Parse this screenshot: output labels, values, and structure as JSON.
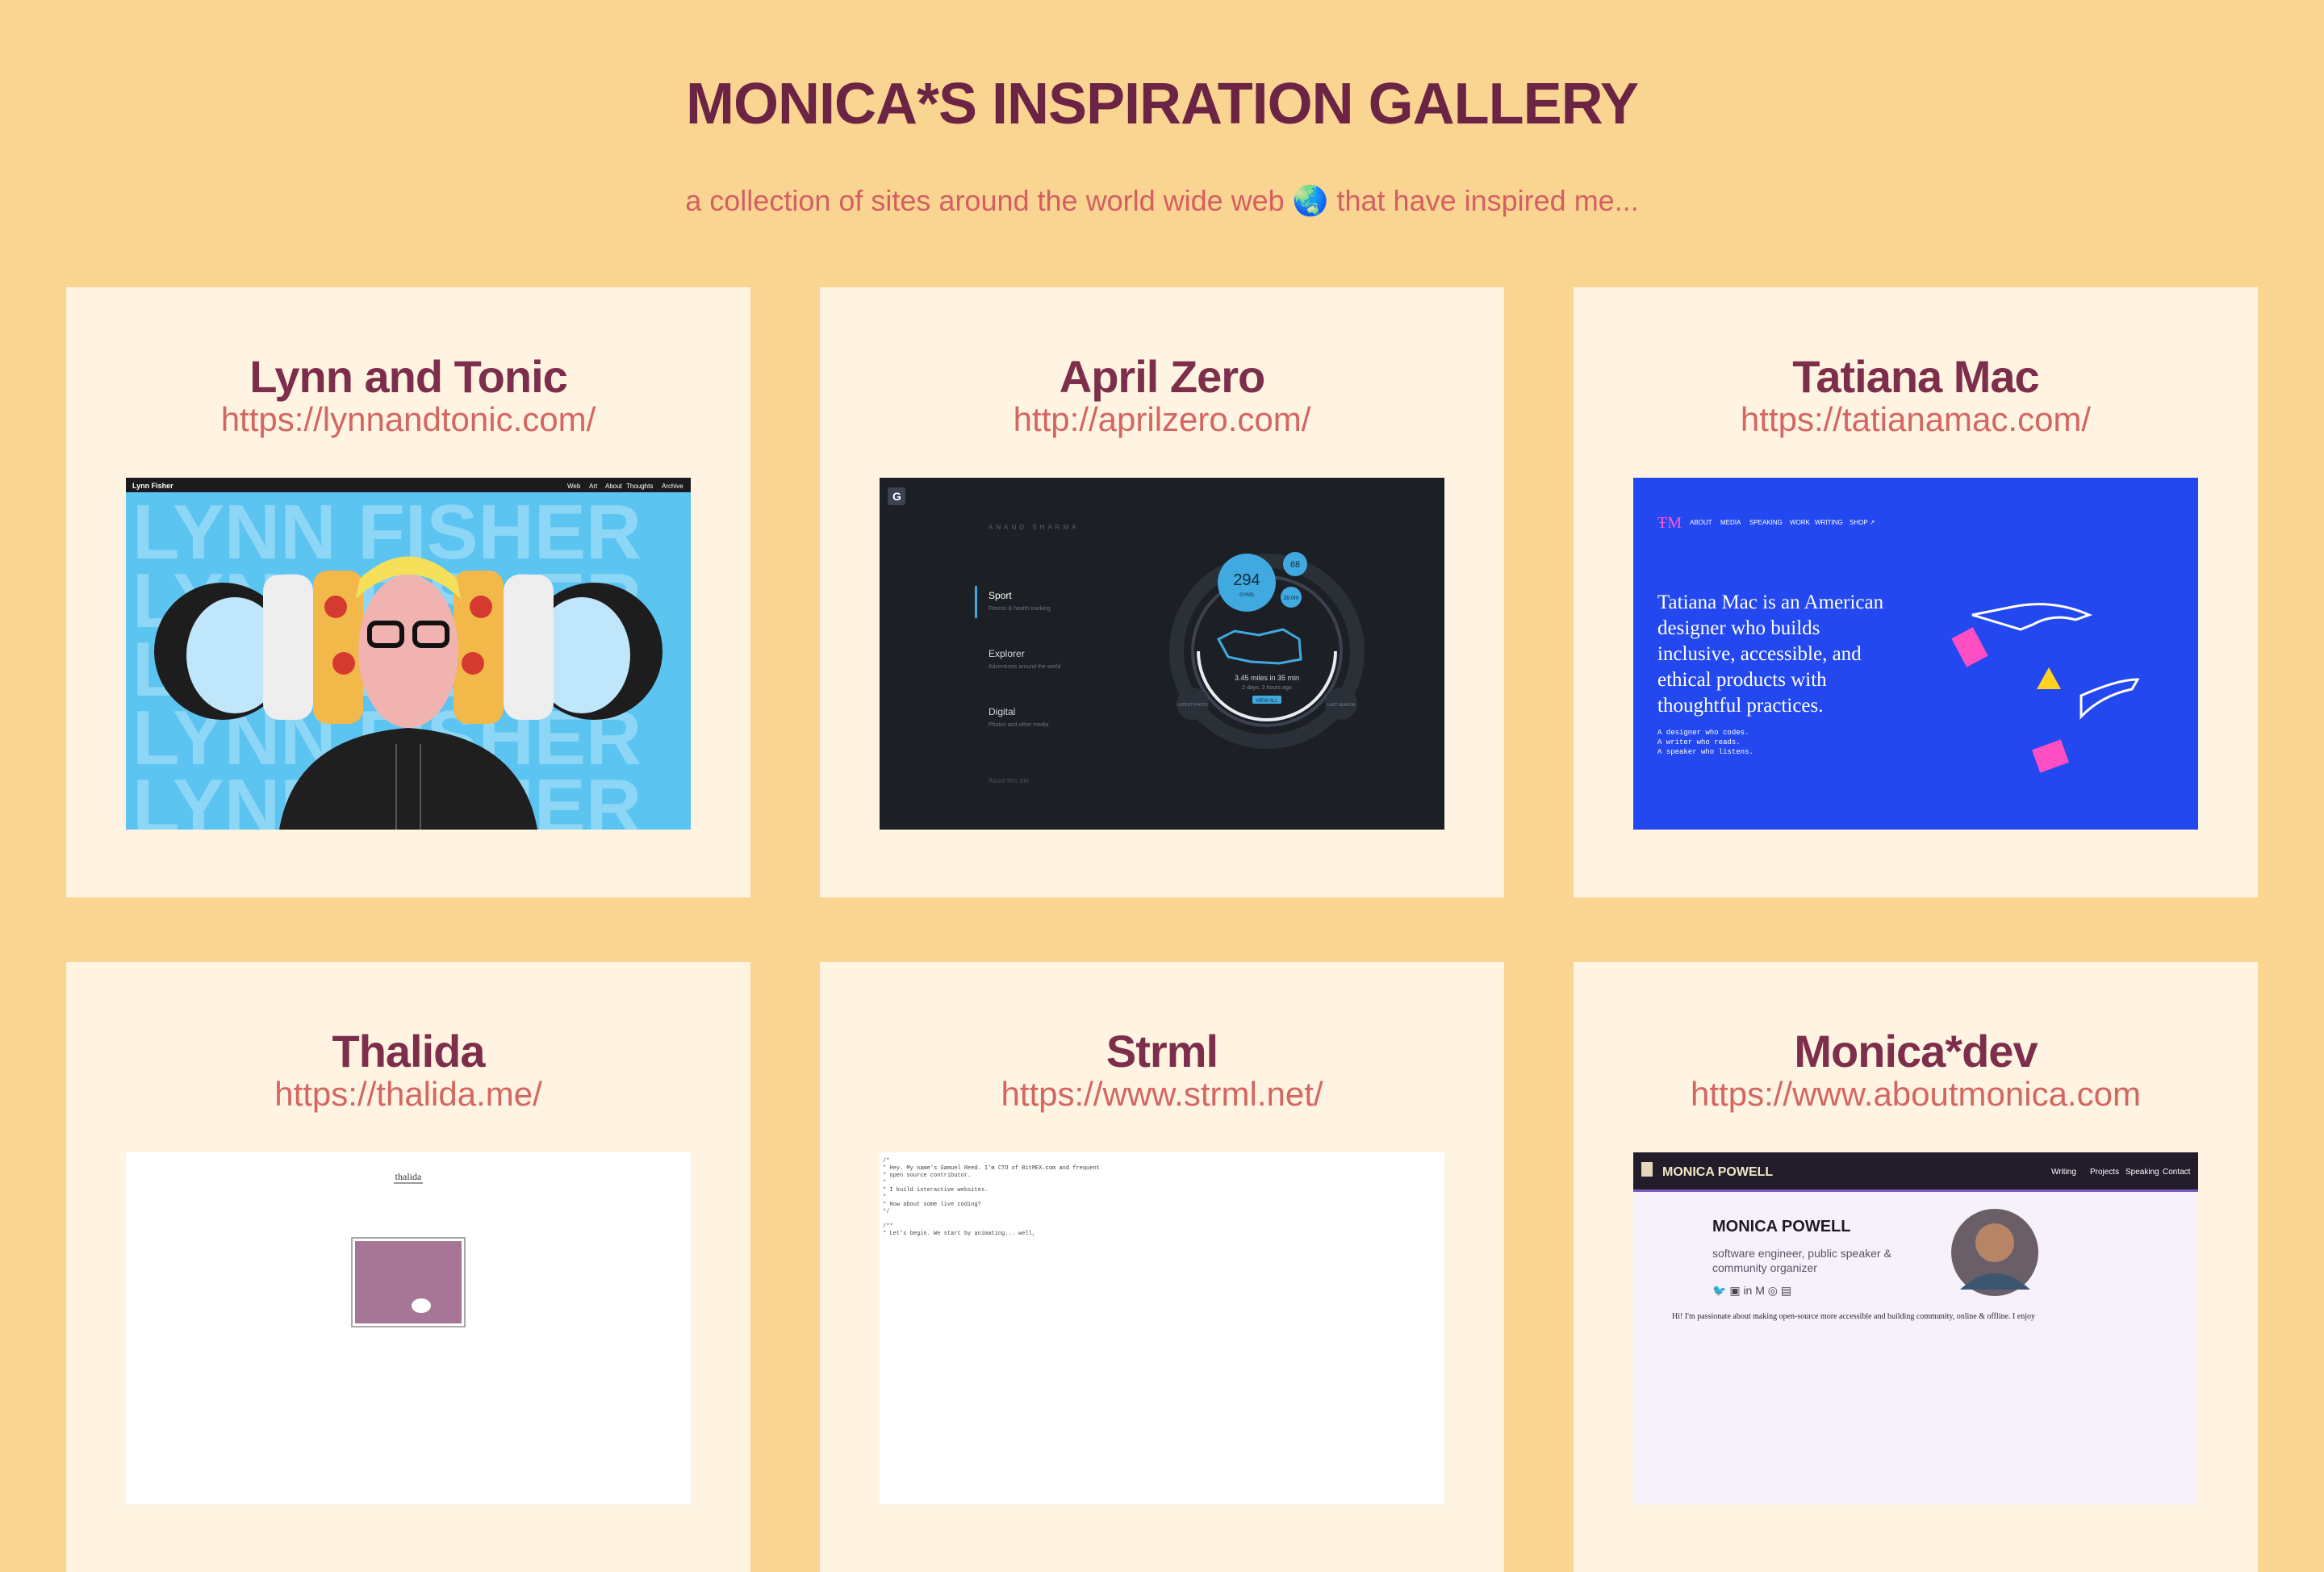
{
  "header": {
    "title": "MONICA*S INSPIRATION GALLERY",
    "subtitle": "a collection of sites around the world wide web 🌏 that have inspired me..."
  },
  "cards": [
    {
      "name": "Lynn and Tonic",
      "url": "https://lynnandtonic.com/",
      "shot": {
        "brand": "Lynn Fisher",
        "nav": [
          "Web",
          "Art",
          "About",
          "Thoughts",
          "Archive"
        ],
        "bg_text": "LYNN FISHER"
      }
    },
    {
      "name": "April Zero",
      "url": "http://aprilzero.com/",
      "shot": {
        "logo": "G",
        "header": "ANAND SHARMA",
        "menu": [
          {
            "label": "Sport",
            "sub": "Fitness & health tracking"
          },
          {
            "label": "Explorer",
            "sub": "Adventures around the world"
          },
          {
            "label": "Digital",
            "sub": "Photos and other media"
          }
        ],
        "footer": "About this site",
        "big_number": "294",
        "big_unit": "GYMS",
        "small_a": "68",
        "small_b": "16.0m",
        "stat": "3.45 miles in 35 min",
        "stat_sub": "2 days, 2 hours ago",
        "button": "VIEW ALL",
        "left_bubble": "LATEST PHOTO",
        "right_bubble": "LAST SEASON"
      }
    },
    {
      "name": "Tatiana Mac",
      "url": "https://tatianamac.com/",
      "shot": {
        "nav": [
          "ABOUT",
          "MEDIA",
          "SPEAKING",
          "WORK",
          "WRITING",
          "SHOP ↗"
        ],
        "headline_lines": [
          "Tatiana Mac is an American",
          "designer who builds",
          "inclusive, accessible, and",
          "ethical products with",
          "thoughtful practices."
        ],
        "sub_lines": [
          "A designer who codes.",
          "A writer who reads.",
          "A speaker who listens."
        ]
      }
    },
    {
      "name": "Thalida",
      "url": "https://thalida.me/",
      "shot": {
        "brand": "thalida"
      }
    },
    {
      "name": "Strml",
      "url": "https://www.strml.net/",
      "shot": {
        "code_lines": [
          "/*",
          " * Hey. My name's Samuel Reed. I'm CTO of BitMEX.com and frequent",
          " * open source contributor.",
          " *",
          " * I build interactive websites.",
          " *",
          " * How about some live coding?",
          " */",
          "",
          "/**",
          " * Let's begin. We start by animating... well,"
        ]
      }
    },
    {
      "name": "Monica*dev",
      "url": "https://www.aboutmonica.com",
      "shot": {
        "brand": "MONICA POWELL",
        "nav": [
          "Writing",
          "Projects",
          "Speaking",
          "Contact"
        ],
        "heading": "MONICA POWELL",
        "tagline_lines": [
          "software engineer, public speaker &",
          "community organizer"
        ],
        "social_icons": "🐦 ▣ in M ◎ ▤",
        "intro": "Hi! I'm passionate about making open-source more accessible and building community, online & offline. I enjoy"
      }
    }
  ]
}
